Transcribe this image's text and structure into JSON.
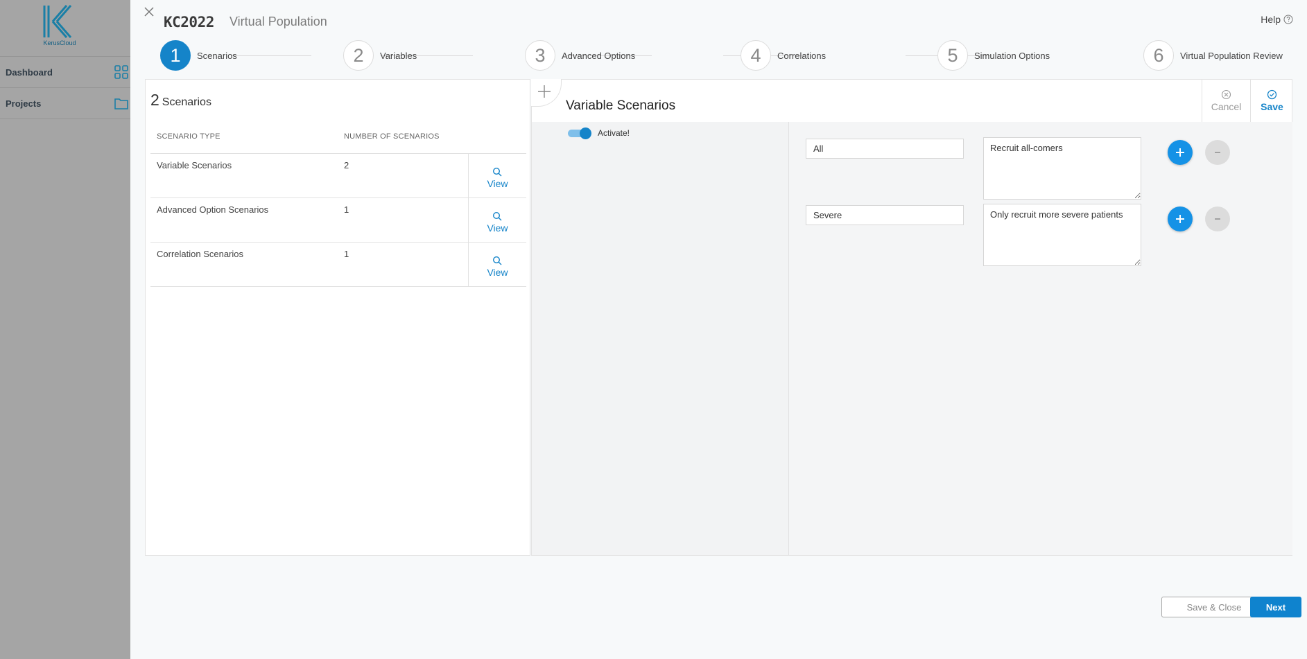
{
  "background_app": {
    "logo_text": "KerusCloud",
    "nav": [
      {
        "label": "Dashboard",
        "icon": "grid-icon"
      },
      {
        "label": "Projects",
        "icon": "folder-icon"
      }
    ]
  },
  "header": {
    "project_code": "KC2022",
    "module_title": "Virtual Population",
    "help_label": "Help"
  },
  "stepper": {
    "active_step": 1,
    "steps": [
      {
        "number": "1",
        "label": "Scenarios"
      },
      {
        "number": "2",
        "label": "Variables"
      },
      {
        "number": "3",
        "label": "Advanced Options"
      },
      {
        "number": "4",
        "label": "Correlations"
      },
      {
        "number": "5",
        "label": "Simulation Options"
      },
      {
        "number": "6",
        "label": "Virtual Population Review"
      }
    ]
  },
  "left_panel": {
    "count": "2",
    "count_label": "Scenarios",
    "columns": [
      "SCENARIO TYPE",
      "NUMBER OF SCENARIOS"
    ],
    "rows": [
      {
        "type": "Variable Scenarios",
        "count": "2",
        "action": "View"
      },
      {
        "type": "Advanced Option Scenarios",
        "count": "1",
        "action": "View"
      },
      {
        "type": "Correlation Scenarios",
        "count": "1",
        "action": "View"
      }
    ]
  },
  "right_panel": {
    "title": "Variable Scenarios",
    "cancel_label": "Cancel",
    "save_label": "Save",
    "activate_label": "Activate!",
    "activate_on": true,
    "scenarios": [
      {
        "name": "All",
        "description": "Recruit all-comers"
      },
      {
        "name": "Severe",
        "description": "Only recruit more severe patients"
      }
    ]
  },
  "footer": {
    "save_close_label": "Save & Close",
    "next_label": "Next"
  },
  "colors": {
    "accent": "#1584c9",
    "plus_button": "#1592e6",
    "backdrop": "#a5a5a5"
  }
}
